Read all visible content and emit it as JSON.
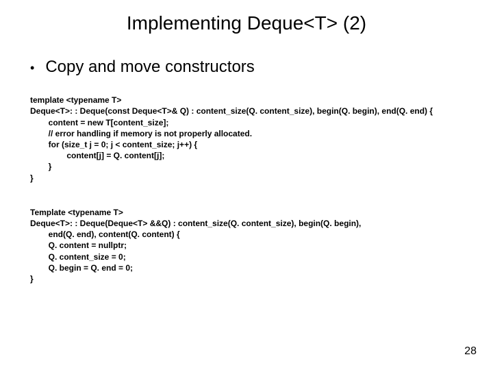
{
  "title": "Implementing Deque<T> (2)",
  "bullet": "Copy and move constructors",
  "code1": {
    "l1": "template <typename T>",
    "l2": "Deque<T>: : Deque(const Deque<T>& Q) : content_size(Q. content_size), begin(Q. begin), end(Q. end) {",
    "l3": "        content = new T[content_size];",
    "l4": "        // error handling if memory is not properly allocated.",
    "l5": "        for (size_t j = 0; j < content_size; j++) {",
    "l6": "                content[j] = Q. content[j];",
    "l7": "        }",
    "l8": "}"
  },
  "code2": {
    "l1": "Template <typename T>",
    "l2": "Deque<T>: : Deque(Deque<T> &&Q) : content_size(Q. content_size), begin(Q. begin),",
    "l3": "        end(Q. end), content(Q. content) {",
    "l4": "        Q. content = nullptr;",
    "l5": "        Q. content_size = 0;",
    "l6": "        Q. begin = Q. end = 0;",
    "l7": "}"
  },
  "page_number": "28"
}
